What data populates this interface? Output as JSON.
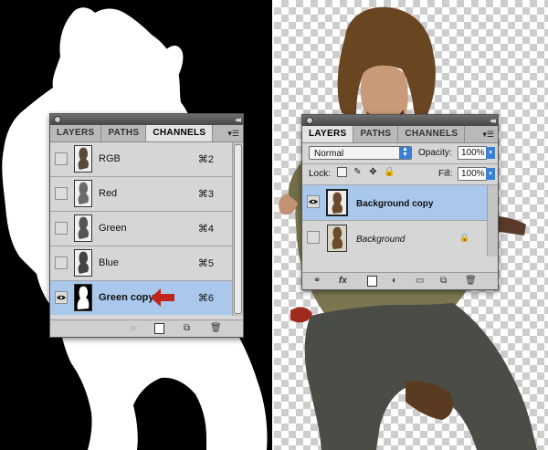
{
  "channels_panel": {
    "tabs": [
      {
        "label": "LAYERS",
        "active": false
      },
      {
        "label": "PATHS",
        "active": false
      },
      {
        "label": "CHANNELS",
        "active": true
      }
    ],
    "rows": [
      {
        "name": "RGB",
        "shortcut": "⌘2",
        "visible": false,
        "selected": false
      },
      {
        "name": "Red",
        "shortcut": "⌘3",
        "visible": false,
        "selected": false
      },
      {
        "name": "Green",
        "shortcut": "⌘4",
        "visible": false,
        "selected": false
      },
      {
        "name": "Blue",
        "shortcut": "⌘5",
        "visible": false,
        "selected": false
      },
      {
        "name": "Green copy",
        "shortcut": "⌘6",
        "visible": true,
        "selected": true
      }
    ],
    "footer_icons": [
      "dotted-circle-icon",
      "mask-icon",
      "new-channel-icon",
      "trash-icon"
    ],
    "arrow_color": "#c0251c"
  },
  "layers_panel": {
    "tabs": [
      {
        "label": "LAYERS",
        "active": true
      },
      {
        "label": "PATHS",
        "active": false
      },
      {
        "label": "CHANNELS",
        "active": false
      }
    ],
    "blend_mode": "Normal",
    "opacity_label": "Opacity:",
    "opacity_value": "100%",
    "lock_label": "Lock:",
    "fill_label": "Fill:",
    "fill_value": "100%",
    "layers": [
      {
        "name": "Background copy",
        "visible": true,
        "selected": true
      },
      {
        "name": "Background",
        "visible": false,
        "selected": false,
        "locked": true
      }
    ],
    "footer_icons": [
      "link-icon",
      "fx-icon",
      "layer-mask-icon",
      "adjustment-icon",
      "folder-icon",
      "new-layer-icon",
      "trash-icon"
    ],
    "footer_fx": "fx"
  },
  "colors": {
    "selection_blue": "#a9c8ec",
    "panel_gray": "#d6d6d6",
    "accent_blue": "#3a7fd6"
  }
}
